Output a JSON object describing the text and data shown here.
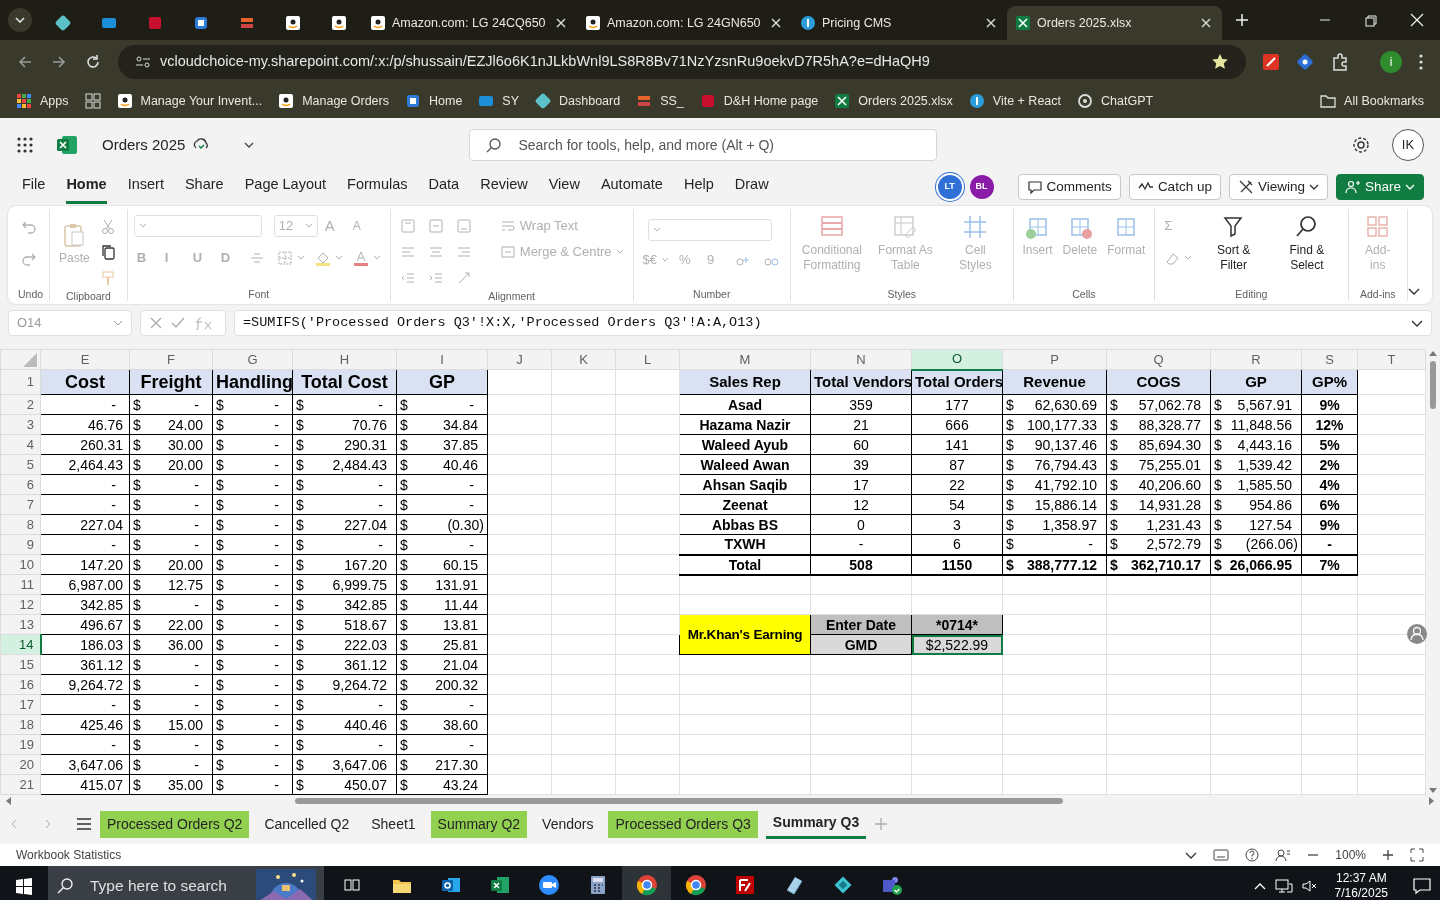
{
  "browser": {
    "tabs": [
      {
        "kind": "icon",
        "selected": false
      },
      {
        "kind": "icon",
        "selected": false
      },
      {
        "kind": "icon",
        "selected": false
      },
      {
        "kind": "icon",
        "selected": false
      },
      {
        "kind": "icon",
        "selected": false
      },
      {
        "kind": "icon",
        "selected": false
      },
      {
        "kind": "icon",
        "selected": false
      },
      {
        "kind": "page",
        "title": "Amazon.com: LG 24CQ650",
        "selected": false
      },
      {
        "kind": "page",
        "title": "Amazon.com: LG 24GN650",
        "selected": false
      },
      {
        "kind": "page",
        "title": "Pricing CMS",
        "selected": false
      },
      {
        "kind": "page",
        "title": "Orders 2025.xlsx",
        "selected": true
      }
    ],
    "url": "vcloudchoice-my.sharepoint.com/:x:/p/shussain/EZJl6o6K1nJLkbWnl9LS8R8Bv71NzYzsnRu9oekvD7R5hA?e=dHaQH9",
    "profile_initial": "i",
    "bookmarks": [
      "Apps",
      "Manage Your Invent...",
      "Manage Orders",
      "Home",
      "SY",
      "Dashboard",
      "SS_",
      "D&H Home page",
      "Orders 2025.xlsx",
      "Vite + React",
      "ChatGPT"
    ],
    "all_bookmarks": "All Bookmarks"
  },
  "app": {
    "title": "Orders 2025",
    "search": {
      "placeholder": "Search for tools, help, and more (Alt + Q)"
    },
    "user_initials": "IK",
    "menu": [
      {
        "label": "File",
        "selected": false
      },
      {
        "label": "Home",
        "selected": true
      },
      {
        "label": "Insert",
        "selected": false
      },
      {
        "label": "Share",
        "selected": false
      },
      {
        "label": "Page Layout",
        "selected": false
      },
      {
        "label": "Formulas",
        "selected": false
      },
      {
        "label": "Data",
        "selected": false
      },
      {
        "label": "Review",
        "selected": false
      },
      {
        "label": "View",
        "selected": false
      },
      {
        "label": "Automate",
        "selected": false
      },
      {
        "label": "Help",
        "selected": false
      },
      {
        "label": "Draw",
        "selected": false
      }
    ],
    "collaborators": [
      {
        "initials": "LT",
        "color": "#2f6fd6"
      },
      {
        "initials": "BL",
        "color": "#8a1aa8"
      }
    ],
    "buttons": [
      {
        "kind": "comments",
        "label": "Comments"
      },
      {
        "kind": "catchup",
        "label": "Catch up"
      },
      {
        "kind": "viewing",
        "label": "Viewing"
      },
      {
        "kind": "share",
        "label": "Share"
      }
    ]
  },
  "ribbon": {
    "groups": [
      {
        "label": "Undo",
        "parts": [
          {
            "kind": "stack",
            "rows": [
              [
                {
                  "kind": "undo",
                  "disabled": true
                }
              ],
              [
                {
                  "kind": "redo",
                  "disabled": true
                }
              ]
            ]
          }
        ]
      },
      {
        "label": "Clipboard",
        "parts": [
          {
            "kind": "large",
            "button": {
              "kind": "paste",
              "label": "Paste",
              "disabled": true
            }
          },
          {
            "kind": "stack",
            "rows": [
              [
                {
                  "kind": "cut",
                  "disabled": true
                }
              ],
              [
                {
                  "kind": "copy",
                  "disabled": false
                }
              ],
              [
                {
                  "kind": "painter",
                  "disabled": true
                }
              ]
            ]
          }
        ]
      },
      {
        "label": "Font",
        "parts": [
          {
            "kind": "stack",
            "rows": [
              [
                {
                  "kind": "fontname",
                  "disabled": true
                },
                {
                  "kind": "fontsize",
                  "label": "12",
                  "disabled": true
                },
                {
                  "kind": "grow",
                  "label": "A",
                  "disabled": true
                },
                {
                  "kind": "shrink",
                  "label": "A",
                  "disabled": true
                }
              ],
              [
                {
                  "kind": "letter",
                  "label": "B",
                  "disabled": true
                },
                {
                  "kind": "letter",
                  "label": "I",
                  "disabled": true
                },
                {
                  "kind": "letter",
                  "label": "U",
                  "disabled": true
                },
                {
                  "kind": "letter",
                  "label": "D",
                  "disabled": true
                },
                {
                  "kind": "strike",
                  "disabled": true
                },
                {
                  "kind": "borders",
                  "disabled": true
                },
                {
                  "kind": "fill",
                  "disabled": true
                },
                {
                  "kind": "fontcolor",
                  "disabled": true
                }
              ]
            ]
          }
        ]
      },
      {
        "label": "Alignment",
        "parts": [
          {
            "kind": "stack",
            "rows": [
              [
                {
                  "kind": "aligntop",
                  "disabled": true
                },
                {
                  "kind": "alignmid",
                  "disabled": true
                },
                {
                  "kind": "alignbot",
                  "disabled": true
                },
                {
                  "kind": "wrap",
                  "label": "Wrap Text",
                  "disabled": true
                }
              ],
              [
                {
                  "kind": "alignleft",
                  "disabled": true
                },
                {
                  "kind": "aligncenter",
                  "disabled": true
                },
                {
                  "kind": "alignright",
                  "disabled": true
                },
                {
                  "kind": "merge",
                  "label": "Merge & Centre",
                  "disabled": true
                }
              ],
              [
                {
                  "kind": "outdent",
                  "disabled": true
                },
                {
                  "kind": "indent",
                  "disabled": true
                },
                {
                  "kind": "orient",
                  "disabled": true
                }
              ]
            ]
          }
        ]
      },
      {
        "label": "Number",
        "parts": [
          {
            "kind": "stack",
            "rows": [
              [
                {
                  "kind": "numformat",
                  "disabled": true
                }
              ],
              [
                {
                  "kind": "textbtn",
                  "label": "$€",
                  "disabled": true
                },
                {
                  "kind": "textbtn",
                  "label": "%",
                  "disabled": true
                },
                {
                  "kind": "textbtn",
                  "label": "9",
                  "disabled": true
                },
                {
                  "kind": "incdec",
                  "disabled": true
                },
                {
                  "kind": "decdec",
                  "disabled": true
                }
              ]
            ]
          }
        ]
      },
      {
        "label": "Styles",
        "parts": [
          {
            "kind": "large",
            "button": {
              "kind": "condfmt",
              "label": "Conditional Formatting",
              "disabled": true
            }
          },
          {
            "kind": "large",
            "button": {
              "kind": "table",
              "label": "Format As Table",
              "disabled": true
            }
          },
          {
            "kind": "large",
            "button": {
              "kind": "cellstyles",
              "label": "Cell Styles",
              "disabled": true
            }
          }
        ]
      },
      {
        "label": "Cells",
        "parts": [
          {
            "kind": "large",
            "button": {
              "kind": "insert",
              "label": "Insert",
              "disabled": true
            }
          },
          {
            "kind": "large",
            "button": {
              "kind": "delete",
              "label": "Delete",
              "disabled": true
            }
          },
          {
            "kind": "large",
            "button": {
              "kind": "format",
              "label": "Format",
              "disabled": true
            }
          }
        ]
      },
      {
        "label": "Editing",
        "parts": [
          {
            "kind": "stack",
            "rows": [
              [
                {
                  "kind": "textbtn",
                  "label": "Σ",
                  "disabled": true
                }
              ],
              [
                {
                  "kind": "clear",
                  "disabled": true
                }
              ]
            ]
          },
          {
            "kind": "large",
            "button": {
              "kind": "sort",
              "label": "Sort & Filter",
              "disabled": false
            }
          },
          {
            "kind": "large",
            "button": {
              "kind": "find",
              "label": "Find & Select",
              "disabled": false
            }
          }
        ]
      },
      {
        "label": "Add-ins",
        "parts": [
          {
            "kind": "large",
            "button": {
              "kind": "addins",
              "label": "Add-ins",
              "disabled": true
            }
          }
        ]
      }
    ]
  },
  "formula_bar": {
    "cell_ref": "O14",
    "formula": "=SUMIFS('Processed Orders Q3'!X:X,'Processed Orders Q3'!A:A,O13)"
  },
  "sheet": {
    "columns": [
      {
        "letter": "E",
        "selected": false
      },
      {
        "letter": "F",
        "selected": false
      },
      {
        "letter": "G",
        "selected": false
      },
      {
        "letter": "H",
        "selected": false
      },
      {
        "letter": "I",
        "selected": false
      },
      {
        "letter": "J",
        "selected": false
      },
      {
        "letter": "K",
        "selected": false
      },
      {
        "letter": "L",
        "selected": false
      },
      {
        "letter": "M",
        "selected": false
      },
      {
        "letter": "N",
        "selected": false
      },
      {
        "letter": "O",
        "selected": true
      },
      {
        "letter": "P",
        "selected": false
      },
      {
        "letter": "Q",
        "selected": false
      },
      {
        "letter": "R",
        "selected": false
      },
      {
        "letter": "S",
        "selected": false
      },
      {
        "letter": "T",
        "selected": false
      }
    ],
    "rows": [
      {
        "number": "1",
        "selected": false
      },
      {
        "number": "2",
        "selected": false
      },
      {
        "number": "3",
        "selected": false
      },
      {
        "number": "4",
        "selected": false
      },
      {
        "number": "5",
        "selected": false
      },
      {
        "number": "6",
        "selected": false
      },
      {
        "number": "7",
        "selected": false
      },
      {
        "number": "8",
        "selected": false
      },
      {
        "number": "9",
        "selected": false
      },
      {
        "number": "10",
        "selected": false
      },
      {
        "number": "11",
        "selected": false
      },
      {
        "number": "12",
        "selected": false
      },
      {
        "number": "13",
        "selected": false
      },
      {
        "number": "14",
        "selected": true
      },
      {
        "number": "15",
        "selected": false
      },
      {
        "number": "16",
        "selected": false
      },
      {
        "number": "17",
        "selected": false
      },
      {
        "number": "18",
        "selected": false
      },
      {
        "number": "19",
        "selected": false
      },
      {
        "number": "20",
        "selected": false
      },
      {
        "number": "21",
        "selected": false
      }
    ]
  },
  "cost_table": {
    "headers": [
      "Cost",
      "Freight",
      "Handling",
      "Total Cost",
      "GP"
    ],
    "rows": [
      [
        "-",
        [
          "$",
          "-"
        ],
        [
          "$",
          "-"
        ],
        [
          "$",
          "-"
        ],
        [
          "$",
          "-"
        ]
      ],
      [
        "46.76",
        [
          "$",
          "24.00"
        ],
        [
          "$",
          "-"
        ],
        [
          "$",
          "70.76"
        ],
        [
          "$",
          "34.84"
        ]
      ],
      [
        "260.31",
        [
          "$",
          "30.00"
        ],
        [
          "$",
          "-"
        ],
        [
          "$",
          "290.31"
        ],
        [
          "$",
          "37.85"
        ]
      ],
      [
        "2,464.43",
        [
          "$",
          "20.00"
        ],
        [
          "$",
          "-"
        ],
        [
          "$",
          "2,484.43"
        ],
        [
          "$",
          "40.46"
        ]
      ],
      [
        "-",
        [
          "$",
          "-"
        ],
        [
          "$",
          "-"
        ],
        [
          "$",
          "-"
        ],
        [
          "$",
          "-"
        ]
      ],
      [
        "-",
        [
          "$",
          "-"
        ],
        [
          "$",
          "-"
        ],
        [
          "$",
          "-"
        ],
        [
          "$",
          "-"
        ]
      ],
      [
        "227.04",
        [
          "$",
          "-"
        ],
        [
          "$",
          "-"
        ],
        [
          "$",
          "227.04"
        ],
        [
          "$",
          "(0.30)"
        ]
      ],
      [
        "-",
        [
          "$",
          "-"
        ],
        [
          "$",
          "-"
        ],
        [
          "$",
          "-"
        ],
        [
          "$",
          "-"
        ]
      ],
      [
        "147.20",
        [
          "$",
          "20.00"
        ],
        [
          "$",
          "-"
        ],
        [
          "$",
          "167.20"
        ],
        [
          "$",
          "60.15"
        ]
      ],
      [
        "6,987.00",
        [
          "$",
          "12.75"
        ],
        [
          "$",
          "-"
        ],
        [
          "$",
          "6,999.75"
        ],
        [
          "$",
          "131.91"
        ]
      ],
      [
        "342.85",
        [
          "$",
          "-"
        ],
        [
          "$",
          "-"
        ],
        [
          "$",
          "342.85"
        ],
        [
          "$",
          "11.44"
        ]
      ],
      [
        "496.67",
        [
          "$",
          "22.00"
        ],
        [
          "$",
          "-"
        ],
        [
          "$",
          "518.67"
        ],
        [
          "$",
          "13.81"
        ]
      ],
      [
        "186.03",
        [
          "$",
          "36.00"
        ],
        [
          "$",
          "-"
        ],
        [
          "$",
          "222.03"
        ],
        [
          "$",
          "25.81"
        ]
      ],
      [
        "361.12",
        [
          "$",
          "-"
        ],
        [
          "$",
          "-"
        ],
        [
          "$",
          "361.12"
        ],
        [
          "$",
          "21.04"
        ]
      ],
      [
        "9,264.72",
        [
          "$",
          "-"
        ],
        [
          "$",
          "-"
        ],
        [
          "$",
          "9,264.72"
        ],
        [
          "$",
          "200.32"
        ]
      ],
      [
        "-",
        [
          "$",
          "-"
        ],
        [
          "$",
          "-"
        ],
        [
          "$",
          "-"
        ],
        [
          "$",
          "-"
        ]
      ],
      [
        "425.46",
        [
          "$",
          "15.00"
        ],
        [
          "$",
          "-"
        ],
        [
          "$",
          "440.46"
        ],
        [
          "$",
          "38.60"
        ]
      ],
      [
        "-",
        [
          "$",
          "-"
        ],
        [
          "$",
          "-"
        ],
        [
          "$",
          "-"
        ],
        [
          "$",
          "-"
        ]
      ],
      [
        "3,647.06",
        [
          "$",
          "-"
        ],
        [
          "$",
          "-"
        ],
        [
          "$",
          "3,647.06"
        ],
        [
          "$",
          "217.30"
        ]
      ],
      [
        "415.07",
        [
          "$",
          "35.00"
        ],
        [
          "$",
          "-"
        ],
        [
          "$",
          "450.07"
        ],
        [
          "$",
          "43.24"
        ]
      ]
    ]
  },
  "sales_table": {
    "headers": [
      "Sales Rep",
      "Total Vendors",
      "Total Orders",
      "Revenue",
      "COGS",
      "GP",
      "GP%"
    ],
    "rows": [
      {
        "kind": "rep",
        "cells": [
          "Asad",
          "359",
          "177",
          [
            "$",
            "62,630.69"
          ],
          [
            "$",
            "57,062.78"
          ],
          [
            "$",
            "5,567.91"
          ],
          "9%"
        ]
      },
      {
        "kind": "rep",
        "cells": [
          "Hazama Nazir",
          "21",
          "666",
          [
            "$",
            "100,177.33"
          ],
          [
            "$",
            "88,328.77"
          ],
          [
            "$",
            "11,848.56"
          ],
          "12%"
        ]
      },
      {
        "kind": "rep",
        "cells": [
          "Waleed Ayub",
          "60",
          "141",
          [
            "$",
            "90,137.46"
          ],
          [
            "$",
            "85,694.30"
          ],
          [
            "$",
            "4,443.16"
          ],
          "5%"
        ]
      },
      {
        "kind": "rep",
        "cells": [
          "Waleed Awan",
          "39",
          "87",
          [
            "$",
            "76,794.43"
          ],
          [
            "$",
            "75,255.01"
          ],
          [
            "$",
            "1,539.42"
          ],
          "2%"
        ]
      },
      {
        "kind": "rep",
        "cells": [
          "Ahsan Saqib",
          "17",
          "22",
          [
            "$",
            "41,792.10"
          ],
          [
            "$",
            "40,206.60"
          ],
          [
            "$",
            "1,585.50"
          ],
          "4%"
        ]
      },
      {
        "kind": "rep",
        "cells": [
          "Zeenat",
          "12",
          "54",
          [
            "$",
            "15,886.14"
          ],
          [
            "$",
            "14,931.28"
          ],
          [
            "$",
            "954.86"
          ],
          "6%"
        ]
      },
      {
        "kind": "rep",
        "cells": [
          "Abbas BS",
          "0",
          "3",
          [
            "$",
            "1,358.97"
          ],
          [
            "$",
            "1,231.43"
          ],
          [
            "$",
            "127.54"
          ],
          "9%"
        ]
      },
      {
        "kind": "rep",
        "cells": [
          "TXWH",
          "-",
          "6",
          [
            "$",
            "-"
          ],
          [
            "$",
            "2,572.79"
          ],
          [
            "$",
            "(266.06)"
          ],
          "-"
        ]
      },
      {
        "kind": "total",
        "cells": [
          "Total",
          "508",
          "1150",
          [
            "$",
            "388,777.12"
          ],
          [
            "$",
            "362,710.17"
          ],
          [
            "$",
            "26,066.95"
          ],
          "7%"
        ]
      }
    ]
  },
  "earning": {
    "label": "Mr.Khan's Earning",
    "fields": [
      {
        "label": "Enter Date",
        "value": "*0714*",
        "selected": false
      },
      {
        "label": "GMD",
        "value": "$2,522.99",
        "selected": true
      }
    ]
  },
  "sheet_tabs": [
    {
      "label": "Processed Orders Q2",
      "color": "#92d050",
      "selected": false
    },
    {
      "label": "Cancelled Q2",
      "selected": false
    },
    {
      "label": "Sheet1",
      "selected": false
    },
    {
      "label": "Summary Q2",
      "color": "#92d050",
      "selected": false
    },
    {
      "label": "Vendors",
      "selected": false
    },
    {
      "label": "Processed Orders Q3",
      "color": "#92d050",
      "selected": false
    },
    {
      "label": "Summary Q3",
      "selected": true
    }
  ],
  "status_bar": {
    "left": "Workbook Statistics",
    "zoom": "100%"
  },
  "taskbar": {
    "search": {
      "placeholder": "Type here to search"
    },
    "time": "12:37 AM",
    "date": "7/16/2025"
  }
}
